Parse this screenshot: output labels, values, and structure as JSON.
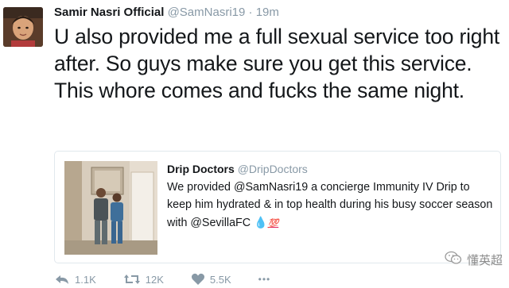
{
  "tweet": {
    "author_name": "Samir Nasri Official",
    "author_handle": "@SamNasri19",
    "separator": "·",
    "time": "19m",
    "text": "U also provided me a full sexual service too right after. So guys make sure you get this service. This whore comes and fucks the same night."
  },
  "quoted_tweet": {
    "author_name": "Drip Doctors",
    "author_handle": "@DripDoctors",
    "text": "We provided @SamNasri19 a concierge Immunity IV Drip to keep him hydrated & in top health during his busy soccer season with @SevillaFC",
    "emoji_1": "💧",
    "emoji_2": "💯"
  },
  "actions": {
    "reply_count": "1.1K",
    "retweet_count": "12K",
    "like_count": "5.5K",
    "more": "•••"
  },
  "watermark": {
    "text": "懂英超"
  },
  "colors": {
    "text": "#14171a",
    "secondary": "#8899a6",
    "border": "#e1e8ed"
  },
  "icons": [
    "avatar",
    "reply-icon",
    "retweet-icon",
    "heart-icon",
    "more-icon",
    "wechat-icon"
  ]
}
